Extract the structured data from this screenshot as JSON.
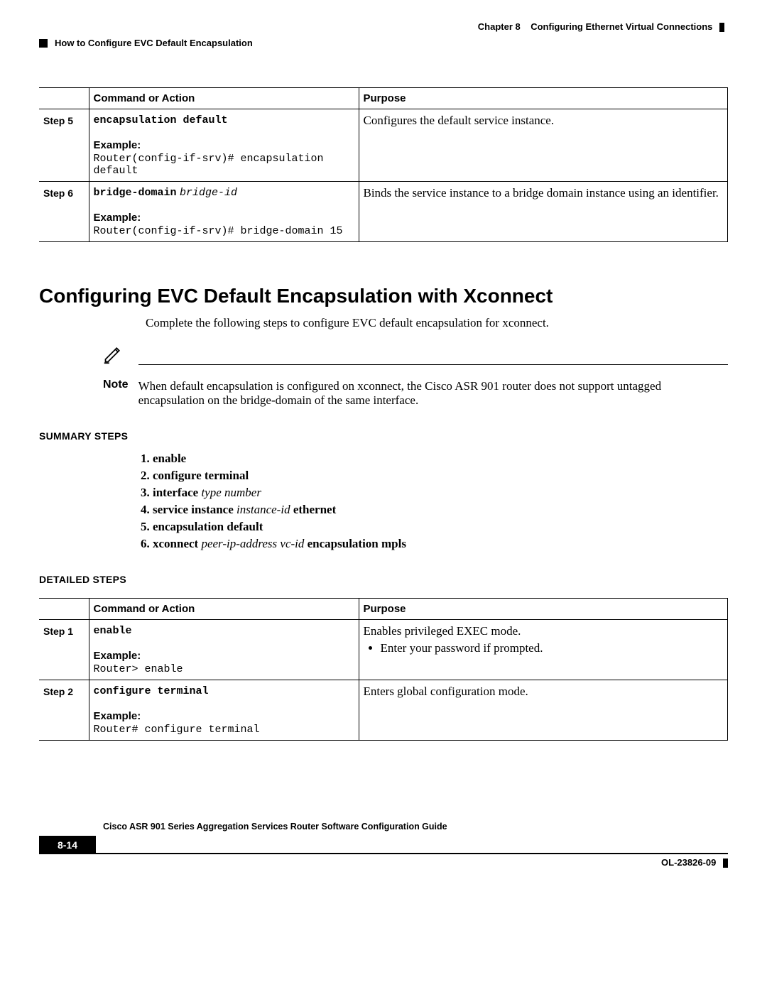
{
  "header": {
    "chapter": "Chapter 8",
    "chapter_title": "Configuring Ethernet Virtual Connections",
    "section": "How to Configure EVC Default Encapsulation"
  },
  "table1": {
    "headers": {
      "command": "Command or Action",
      "purpose": "Purpose"
    },
    "example_label": "Example:",
    "rows": [
      {
        "step": "Step 5",
        "command_bold": "encapsulation default",
        "command_ital": "",
        "example": "Router(config-if-srv)# encapsulation default",
        "purpose": "Configures the default service instance."
      },
      {
        "step": "Step 6",
        "command_bold": "bridge-domain",
        "command_ital": "bridge-id",
        "example": "Router(config-if-srv)# bridge-domain 15",
        "purpose": "Binds the service instance to a bridge domain instance using an identifier."
      }
    ]
  },
  "h1": "Configuring EVC Default Encapsulation with Xconnect",
  "intro": "Complete the following steps to configure EVC default encapsulation for xconnect.",
  "note": {
    "label": "Note",
    "text": "When default encapsulation is configured on xconnect, the Cisco ASR 901 router does not support untagged encapsulation on the bridge-domain of the same interface."
  },
  "summary_steps": {
    "heading": "SUMMARY STEPS",
    "items": [
      {
        "bold": "enable",
        "ital": "",
        "trail": ""
      },
      {
        "bold": "configure terminal",
        "ital": "",
        "trail": ""
      },
      {
        "bold": "interface",
        "ital": "type number",
        "trail": ""
      },
      {
        "bold": "service instance",
        "ital": "instance-id",
        "trail": "ethernet"
      },
      {
        "bold": "encapsulation default",
        "ital": "",
        "trail": ""
      },
      {
        "bold": "xconnect",
        "ital": "peer-ip-address vc-id",
        "trail": "encapsulation mpls"
      }
    ]
  },
  "detailed_steps_heading": "DETAILED STEPS",
  "table2": {
    "headers": {
      "command": "Command or Action",
      "purpose": "Purpose"
    },
    "example_label": "Example:",
    "rows": [
      {
        "step": "Step 1",
        "command_bold": "enable",
        "command_ital": "",
        "example": "Router> enable",
        "purpose": "Enables privileged EXEC mode.",
        "bullet": "Enter your password if prompted."
      },
      {
        "step": "Step 2",
        "command_bold": "configure terminal",
        "command_ital": "",
        "example": "Router# configure terminal",
        "purpose": "Enters global configuration mode."
      }
    ]
  },
  "footer": {
    "guide": "Cisco ASR 901 Series Aggregation Services Router Software Configuration Guide",
    "page": "8-14",
    "docnum": "OL-23826-09"
  }
}
